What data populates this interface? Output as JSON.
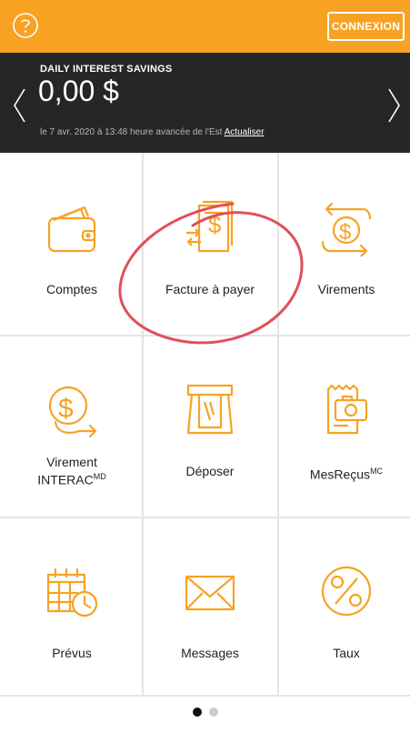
{
  "header": {
    "help_icon": "help-circle-icon",
    "connect_label": "CONNEXION"
  },
  "account": {
    "name": "DAILY INTEREST SAVINGS",
    "balance": "0,00 $",
    "timestamp": "le 7 avr. 2020 à 13:48 heure avancée de l'Est",
    "refresh_label": "Actualiser"
  },
  "tiles": [
    {
      "label": "Comptes",
      "icon": "wallet-icon"
    },
    {
      "label": "Facture à payer",
      "icon": "bill-payment-icon"
    },
    {
      "label": "Virements",
      "icon": "transfer-icon"
    },
    {
      "label": "Virement",
      "label2": "INTERAC",
      "sup": "MD",
      "icon": "interac-transfer-icon"
    },
    {
      "label": "Déposer",
      "icon": "deposit-icon"
    },
    {
      "label": "MesReçus",
      "sup": "MC",
      "icon": "receipt-camera-icon"
    },
    {
      "label": "Prévus",
      "icon": "scheduled-calendar-icon"
    },
    {
      "label": "Messages",
      "icon": "envelope-icon"
    },
    {
      "label": "Taux",
      "icon": "percent-icon"
    }
  ],
  "pager": {
    "pages": 2,
    "current": 1
  },
  "colors": {
    "accent": "#f7a223",
    "dark": "#262626",
    "highlight": "#e0505a"
  }
}
